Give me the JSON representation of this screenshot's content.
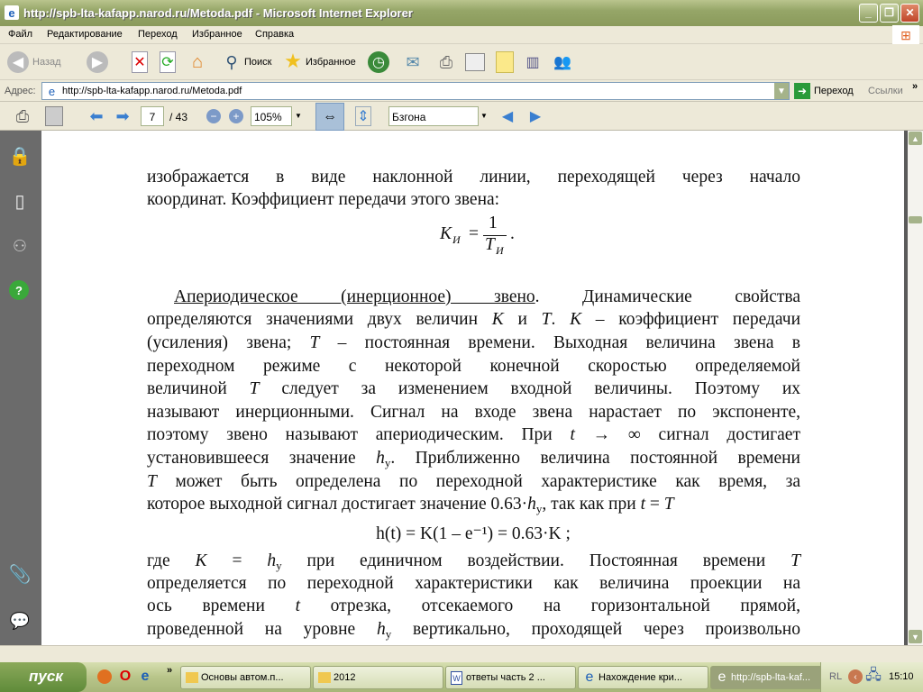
{
  "window": {
    "title": "http://spb-lta-kafapp.narod.ru/Metoda.pdf - Microsoft Internet Explorer",
    "minimize": "_",
    "maximize": "❐",
    "close": "✕"
  },
  "menu": [
    "Файл",
    "Редактирование",
    "Переход",
    "Избранное",
    "Справка"
  ],
  "toolbar": {
    "back": "Назад",
    "search": "Поиск",
    "favorites": "Избранное"
  },
  "address": {
    "label": "Адрес:",
    "url": "http://spb-lta-kafapp.narod.ru/Metoda.pdf",
    "go": "Переход",
    "links": "Ссылки",
    "more": "»"
  },
  "pdf": {
    "page": "7",
    "total": "/ 43",
    "zoom": "105%",
    "find": "Бзгона"
  },
  "doc": {
    "lines": [
      [
        [
          "изображается в виде наклонной линии, переходящей через начало",
          "n"
        ]
      ],
      [
        [
          "координат. Коэффициент передачи этого звена:",
          "n"
        ]
      ],
      [
        [
          "Апериодическое (инерционное) звено",
          "u"
        ],
        [
          ". Динамические свойства",
          "n"
        ]
      ],
      [
        [
          "определяются значениями двух величин ",
          "n"
        ],
        [
          "K",
          "i"
        ],
        [
          " и ",
          "n"
        ],
        [
          "T",
          "i"
        ],
        [
          ". ",
          "n"
        ],
        [
          "K",
          "i"
        ],
        [
          " – коэффициент передачи",
          "n"
        ]
      ],
      [
        [
          "(усиления) звена; ",
          "n"
        ],
        [
          "T",
          "i"
        ],
        [
          " – постоянная времени. Выходная величина звена в",
          "n"
        ]
      ],
      [
        [
          "переходном режиме с некоторой конечной скоростью определяемой",
          "n"
        ]
      ],
      [
        [
          "величиной ",
          "n"
        ],
        [
          "T",
          "i"
        ],
        [
          " следует за изменением входной величины. Поэтому их",
          "n"
        ]
      ],
      [
        [
          "называют инерционными. Сигнал на входе звена нарастает по экспоненте,",
          "n"
        ]
      ],
      [
        [
          "поэтому звено называют апериодическим. При ",
          "n"
        ],
        [
          "t",
          "i"
        ],
        [
          " → ∞ сигнал достигает",
          "n"
        ]
      ],
      [
        [
          "установившееся значение ",
          "n"
        ],
        [
          "h",
          "i"
        ],
        [
          "у",
          "sub"
        ],
        [
          ". Приближенно величина постоянной времени",
          "n"
        ]
      ],
      [
        [
          "T",
          "i"
        ],
        [
          " может быть определена по переходной характеристике как время, за",
          "n"
        ]
      ],
      [
        [
          "которое выходной сигнал достигает значение 0.63·",
          "n"
        ],
        [
          "h",
          "i"
        ],
        [
          "у",
          "sub"
        ],
        [
          ", так как при ",
          "n"
        ],
        [
          "t",
          "i"
        ],
        [
          " = ",
          "n"
        ],
        [
          "T",
          "i"
        ]
      ],
      [
        [
          "где ",
          "n"
        ],
        [
          "K",
          "i"
        ],
        [
          " = ",
          "n"
        ],
        [
          "h",
          "i"
        ],
        [
          "у",
          "sub"
        ],
        [
          " при единичном воздействии. Постоянная времени ",
          "n"
        ],
        [
          "T",
          "i"
        ]
      ],
      [
        [
          "определяется по переходной характеристики как величина проекции на",
          "n"
        ]
      ],
      [
        [
          "ось времени ",
          "n"
        ],
        [
          "t",
          "i"
        ],
        [
          " отрезка, отсекаемого на горизонтальной прямой,",
          "n"
        ]
      ],
      [
        [
          "проведенной на уровне ",
          "n"
        ],
        [
          "h",
          "i"
        ],
        [
          "у",
          "sub"
        ],
        [
          " вертикально, проходящей через произвольно",
          "n"
        ]
      ]
    ],
    "formula1": {
      "lhs": "K",
      "lhs_sub": "И",
      "eq": "=",
      "num": "1",
      "den": "T",
      "den_sub": "И",
      "end": "."
    },
    "formula2": "h(t) = K(1 – e⁻¹) = 0.63·K ;"
  },
  "taskbar": {
    "start": "пуск",
    "more": "»",
    "tasks": [
      "Основы автом.п...",
      "2012",
      "ответы часть 2 ...",
      "Нахождение кри...",
      "http://spb-lta-kaf..."
    ],
    "lang": "RL",
    "clock": "15:10"
  }
}
